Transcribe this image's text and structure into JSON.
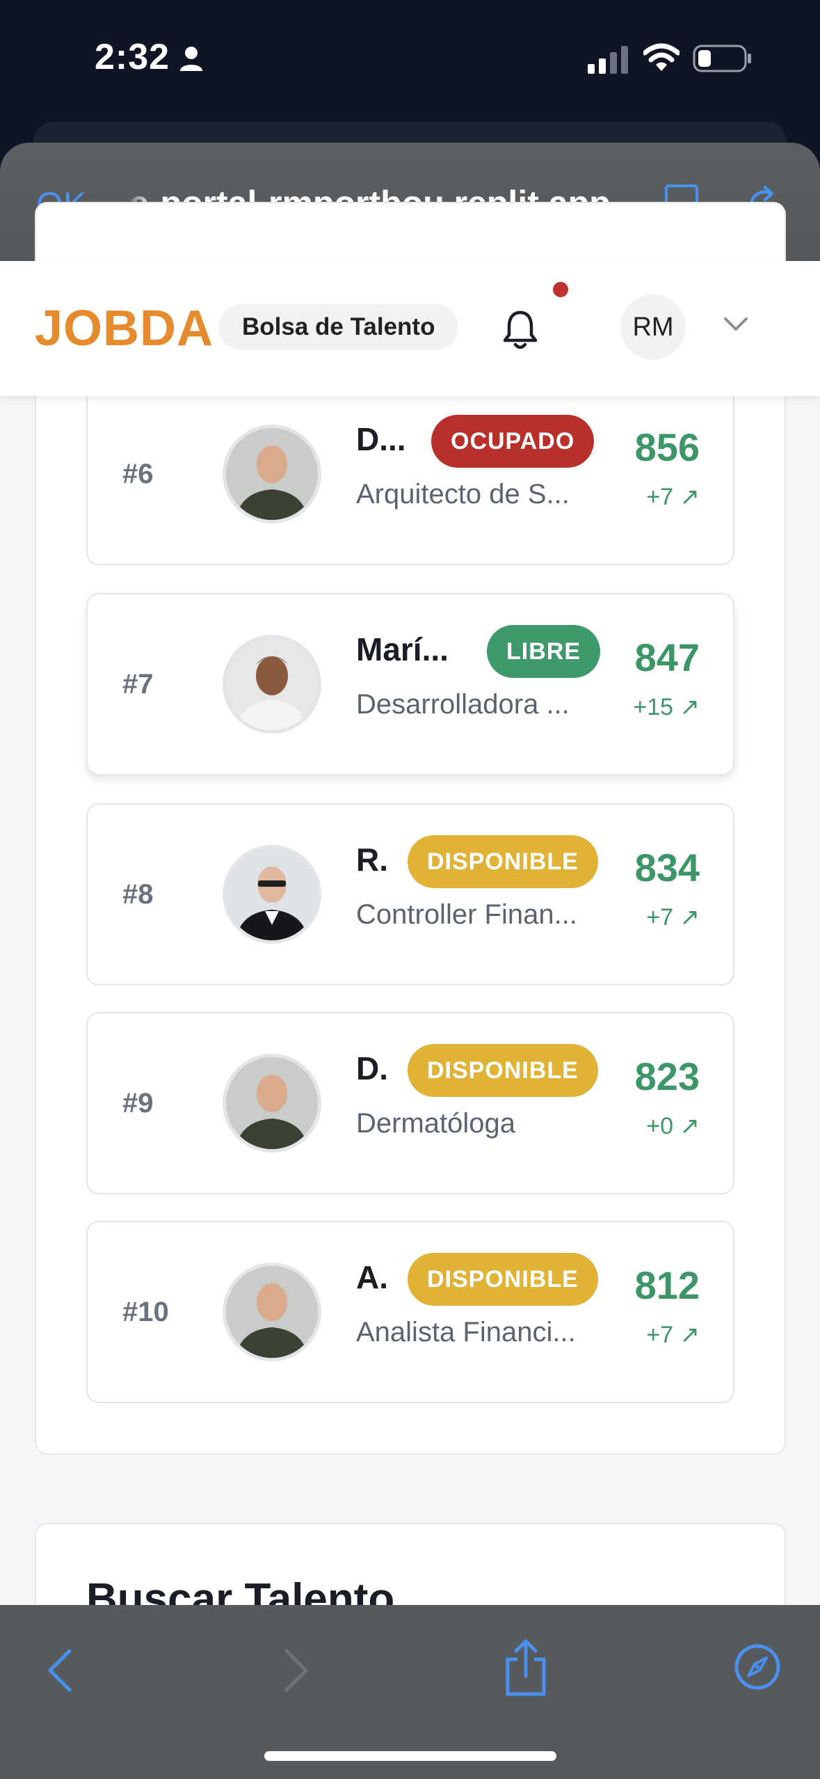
{
  "status_bar": {
    "time": "2:32"
  },
  "browser": {
    "done_label": "OK",
    "url": "e-portal-rmportbou.replit.app"
  },
  "header": {
    "logo": "JOBDA",
    "section_pill": "Bolsa de Talento",
    "avatar_initials": "RM"
  },
  "ranking": {
    "rows": [
      {
        "rank": "#6",
        "name": "D...",
        "status": "OCUPADO",
        "role": "Arquitecto de S...",
        "score": "856",
        "delta": "+7 ↗"
      },
      {
        "rank": "#7",
        "name": "Marí...",
        "status": "LIBRE",
        "role": "Desarrolladora ...",
        "score": "847",
        "delta": "+15 ↗"
      },
      {
        "rank": "#8",
        "name": "R.",
        "status": "DISPONIBLE",
        "role": "Controller Finan...",
        "score": "834",
        "delta": "+7 ↗"
      },
      {
        "rank": "#9",
        "name": "D.",
        "status": "DISPONIBLE",
        "role": "Dermatóloga",
        "score": "823",
        "delta": "+0 ↗"
      },
      {
        "rank": "#10",
        "name": "A.",
        "status": "DISPONIBLE",
        "role": "Analista Financi...",
        "score": "812",
        "delta": "+7 ↗"
      }
    ]
  },
  "search": {
    "title": "Buscar Talento"
  },
  "colors": {
    "ocupado": "#b8302a",
    "libre": "#3e9a6b",
    "disponible": "#e0b236",
    "score": "#3d9667",
    "brand": "#e68a2e"
  },
  "icons": {
    "notifications": "bell-icon",
    "user_menu": "chevron-down-icon",
    "reader": "reader-mode-icon",
    "reload": "reload-icon",
    "back": "chevron-left-icon",
    "forward": "chevron-right-icon",
    "share": "share-icon",
    "safari": "compass-icon"
  }
}
